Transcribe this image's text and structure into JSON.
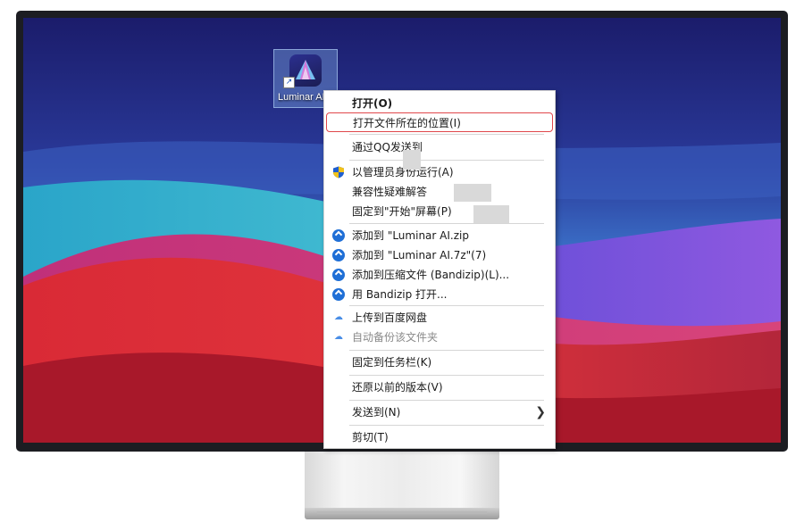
{
  "desktop": {
    "icon_label": "Luminar AI",
    "icon_name": "luminar-ai-icon"
  },
  "context_menu": {
    "items": [
      {
        "label": "打开(O)"
      },
      {
        "label": "打开文件所在的位置(I)"
      },
      {
        "label": "通过QQ发送到"
      },
      {
        "label": "以管理员身份运行(A)",
        "icon": "uac-shield-icon"
      },
      {
        "label": "兼容性疑难解答"
      },
      {
        "label": "固定到\"开始\"屏幕(P)"
      },
      {
        "label": "添加到 \"Luminar AI.zip",
        "icon": "bandizip-icon"
      },
      {
        "label": "添加到 \"Luminar AI.7z\"(7)",
        "icon": "bandizip-icon"
      },
      {
        "label": "添加到压缩文件 (Bandizip)(L)...",
        "icon": "bandizip-icon"
      },
      {
        "label": "用 Bandizip 打开...",
        "icon": "bandizip-icon"
      },
      {
        "label": "上传到百度网盘",
        "icon": "baidu-cloud-icon"
      },
      {
        "label": "自动备份该文件夹",
        "icon": "baidu-cloud-icon"
      },
      {
        "label": "固定到任务栏(K)"
      },
      {
        "label": "还原以前的版本(V)"
      },
      {
        "label": "发送到(N)",
        "icon": "chevron-right-icon"
      },
      {
        "label": "剪切(T)"
      }
    ]
  },
  "colors": {
    "highlight_border": "#e0474b",
    "bandizip_blue": "#1f6fd6"
  }
}
